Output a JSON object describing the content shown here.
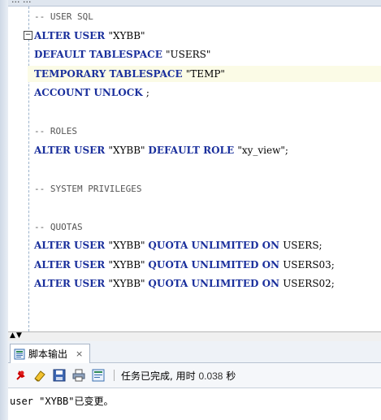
{
  "top_tab_fragment": "... ...",
  "editor": {
    "lines": [
      {
        "parts": [
          {
            "t": "-- USER SQL",
            "c": "cm"
          }
        ]
      },
      {
        "parts": [
          {
            "t": "ALTER USER ",
            "c": "kw"
          },
          {
            "t": "\"XYBB\"",
            "c": "txt"
          }
        ]
      },
      {
        "parts": [
          {
            "t": "DEFAULT TABLESPACE ",
            "c": "kw"
          },
          {
            "t": "\"USERS\"",
            "c": "txt"
          }
        ]
      },
      {
        "parts": [
          {
            "t": "TEMPORARY TABLESPACE ",
            "c": "kw"
          },
          {
            "t": "\"TEMP\"",
            "c": "txt"
          }
        ]
      },
      {
        "parts": [
          {
            "t": "ACCOUNT UNLOCK ",
            "c": "kw"
          },
          {
            "t": ";",
            "c": "txt"
          }
        ]
      },
      {
        "parts": [
          {
            "t": "",
            "c": "txt"
          }
        ]
      },
      {
        "parts": [
          {
            "t": "-- ROLES",
            "c": "cm"
          }
        ]
      },
      {
        "parts": [
          {
            "t": "ALTER USER ",
            "c": "kw"
          },
          {
            "t": "\"XYBB\" ",
            "c": "txt"
          },
          {
            "t": "DEFAULT ROLE ",
            "c": "kw"
          },
          {
            "t": "\"xy_view\";",
            "c": "txt"
          }
        ]
      },
      {
        "parts": [
          {
            "t": "",
            "c": "txt"
          }
        ]
      },
      {
        "parts": [
          {
            "t": "-- SYSTEM PRIVILEGES",
            "c": "cm"
          }
        ]
      },
      {
        "parts": [
          {
            "t": "",
            "c": "txt"
          }
        ]
      },
      {
        "parts": [
          {
            "t": "-- QUOTAS",
            "c": "cm"
          }
        ]
      },
      {
        "parts": [
          {
            "t": "ALTER USER ",
            "c": "kw"
          },
          {
            "t": "\"XYBB\" ",
            "c": "txt"
          },
          {
            "t": "QUOTA UNLIMITED ON ",
            "c": "kw"
          },
          {
            "t": "USERS;",
            "c": "txt"
          }
        ]
      },
      {
        "parts": [
          {
            "t": "ALTER USER ",
            "c": "kw"
          },
          {
            "t": "\"XYBB\" ",
            "c": "txt"
          },
          {
            "t": "QUOTA UNLIMITED ON ",
            "c": "kw"
          },
          {
            "t": "USERS03;",
            "c": "txt"
          }
        ]
      },
      {
        "parts": [
          {
            "t": "ALTER USER ",
            "c": "kw"
          },
          {
            "t": "\"XYBB\" ",
            "c": "txt"
          },
          {
            "t": "QUOTA UNLIMITED ON ",
            "c": "kw"
          },
          {
            "t": "USERS02;",
            "c": "txt"
          }
        ]
      }
    ],
    "highlighted_line": 3,
    "fold_marker": "−"
  },
  "output_panel": {
    "tab_label": "脚本输出",
    "tab_close": "×",
    "status_text": "任务已完成, 用时 ",
    "status_time": "0.038",
    "status_unit": " 秒",
    "message": "user \"XYBB\"已变更。"
  },
  "icons": [
    "pin-icon",
    "eraser-icon",
    "save-icon",
    "print-icon",
    "script-icon"
  ],
  "colors": {
    "keyword": "#1a2f9c",
    "highlight": "#fbfbe6"
  }
}
